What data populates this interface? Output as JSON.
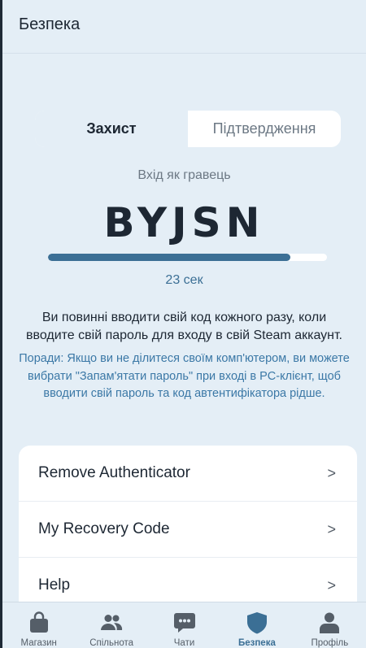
{
  "header": {
    "title": "Безпека"
  },
  "segments": {
    "active": "Захист",
    "inactive": "Підтвердження"
  },
  "guard": {
    "login_as": "Вхід як гравець",
    "code": "BYJSN",
    "progress_fraction": 0.87,
    "timer": "23 сек"
  },
  "info": {
    "text": "Ви повинні вводити свій код кожного разу, коли вводите свій пароль для входу в свій Steam аккаунт.",
    "tips": "Поради: Якщо ви не ділитеся своїм комп'ютером, ви можете вибрати \"Запам'ятати пароль\" при вході в PC-клієнт, щоб вводити свій пароль та код автентифікатора рідше."
  },
  "menu": {
    "items": [
      {
        "label": "Remove Authenticator",
        "chevron": ">"
      },
      {
        "label": "My Recovery Code",
        "chevron": ">"
      },
      {
        "label": "Help",
        "chevron": ">"
      }
    ]
  },
  "tabbar": {
    "tabs": [
      {
        "label": "Магазин",
        "icon": "shopping-bag-icon"
      },
      {
        "label": "Спільнота",
        "icon": "people-icon"
      },
      {
        "label": "Чати",
        "icon": "chat-bubble-icon"
      },
      {
        "label": "Безпека",
        "icon": "shield-icon"
      },
      {
        "label": "Профіль",
        "icon": "person-icon"
      }
    ],
    "active_index": 3
  },
  "colors": {
    "accent": "#3b6f95",
    "background": "#e4eef6",
    "tips_text": "#3b78a6",
    "icon_gray": "#555e68"
  }
}
